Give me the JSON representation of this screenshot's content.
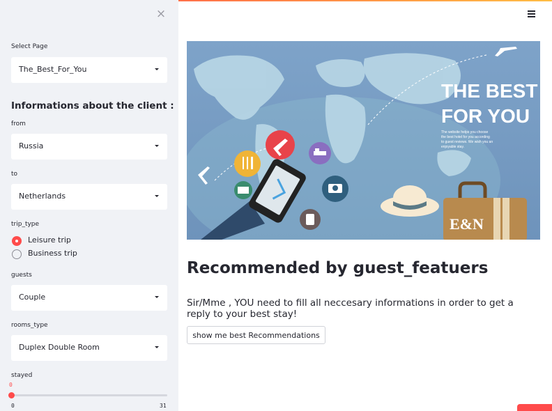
{
  "sidebar": {
    "close_label": "×",
    "select_page": {
      "label": "Select Page",
      "value": "The_Best_For_You"
    },
    "section_title": "Informations about the client :",
    "from": {
      "label": "from",
      "value": "Russia"
    },
    "to": {
      "label": "to",
      "value": "Netherlands"
    },
    "trip_type": {
      "label": "trip_type",
      "options": [
        {
          "label": "Leisure trip",
          "selected": true
        },
        {
          "label": "Business trip",
          "selected": false
        }
      ]
    },
    "guests": {
      "label": "guests",
      "value": "Couple"
    },
    "rooms_type": {
      "label": "rooms_type",
      "value": "Duplex Double Room"
    },
    "stayed": {
      "label": "stayed",
      "value": "0",
      "min": "0",
      "max": "31"
    }
  },
  "main": {
    "banner": {
      "title_line1": "THE BEST",
      "title_line2": "FOR YOU",
      "body": [
        "The website helps you choose",
        "the best hotel for you according",
        "to guest reviews. We wish you an",
        "enjoyable stay."
      ],
      "brand": "E&N"
    },
    "heading": "Recommended by guest_featuers",
    "description": "Sir/Mme , YOU need to fill all neccesary informations in order to get a reply to your best stay!",
    "button_label": "show me best Recommendations"
  },
  "colors": {
    "accent": "#ff4b4b",
    "sidebar_bg": "#f0f2f6",
    "banner_bg": "#7a9fc5"
  }
}
